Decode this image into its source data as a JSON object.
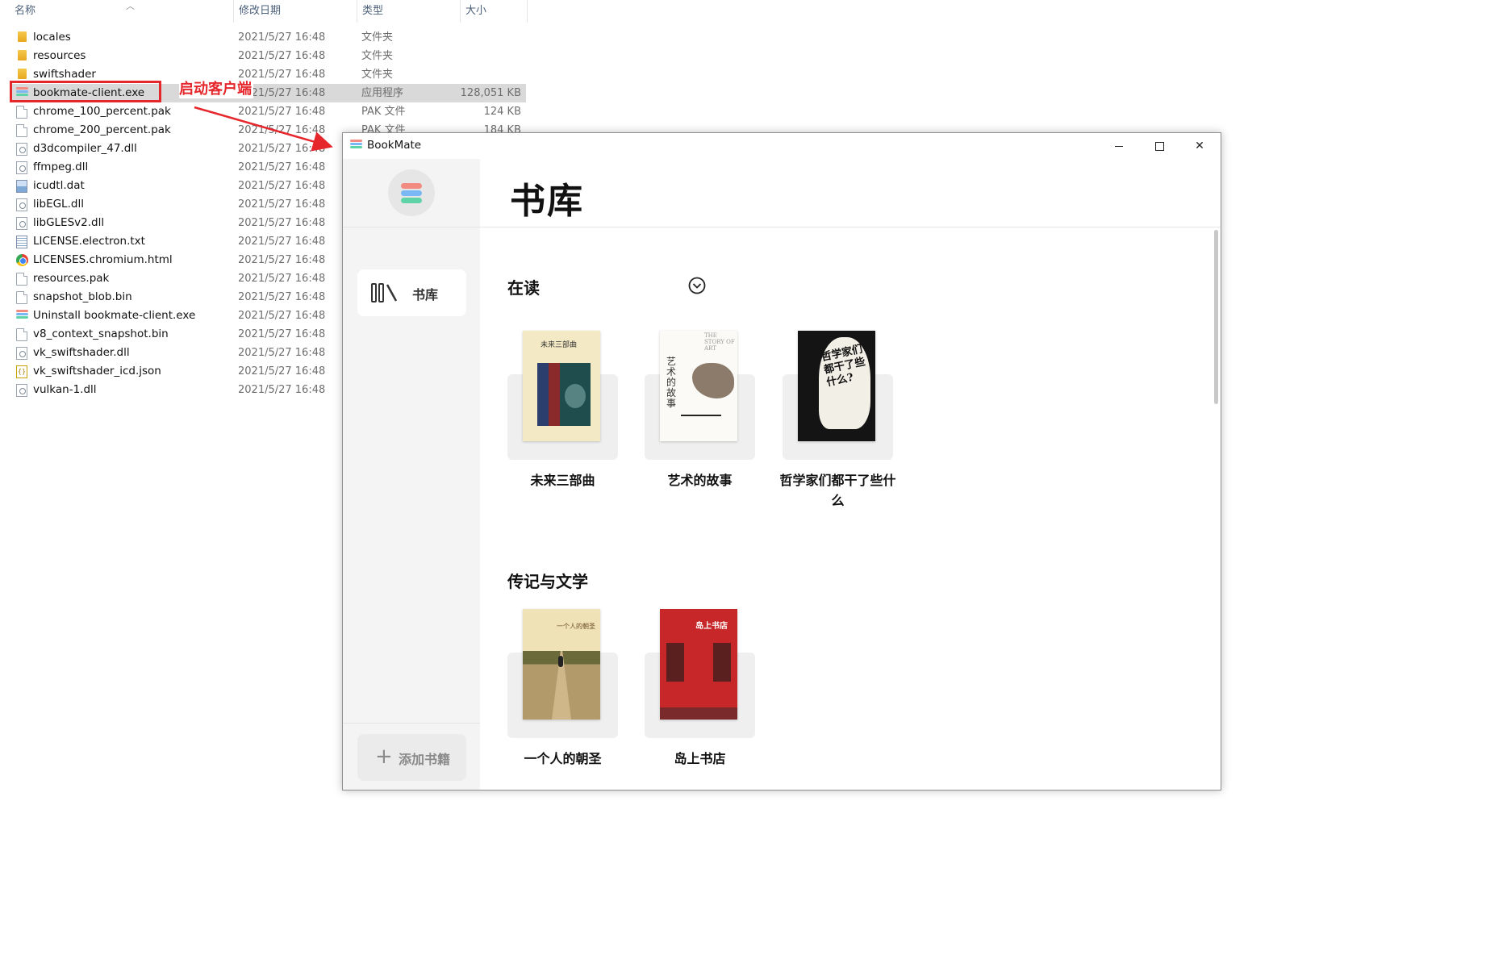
{
  "explorer": {
    "columns": {
      "name": "名称",
      "date": "修改日期",
      "type": "类型",
      "size": "大小"
    },
    "files": [
      {
        "name": "locales",
        "date": "2021/5/27 16:48",
        "type": "文件夹",
        "size": "",
        "icon": "folder-icon"
      },
      {
        "name": "resources",
        "date": "2021/5/27 16:48",
        "type": "文件夹",
        "size": "",
        "icon": "folder-icon"
      },
      {
        "name": "swiftshader",
        "date": "2021/5/27 16:48",
        "type": "文件夹",
        "size": "",
        "icon": "folder-icon"
      },
      {
        "name": "bookmate-client.exe",
        "date": "2021/5/27 16:48",
        "type": "应用程序",
        "size": "128,051 KB",
        "icon": "bookmate-app-icon"
      },
      {
        "name": "chrome_100_percent.pak",
        "date": "2021/5/27 16:48",
        "type": "PAK 文件",
        "size": "124 KB",
        "icon": "file-icon"
      },
      {
        "name": "chrome_200_percent.pak",
        "date": "2021/5/27 16:48",
        "type": "PAK 文件",
        "size": "184 KB",
        "icon": "file-icon"
      },
      {
        "name": "d3dcompiler_47.dll",
        "date": "2021/5/27 16:48",
        "type": "",
        "size": "",
        "icon": "dll-file-icon"
      },
      {
        "name": "ffmpeg.dll",
        "date": "2021/5/27 16:48",
        "type": "",
        "size": "",
        "icon": "dll-file-icon"
      },
      {
        "name": "icudtl.dat",
        "date": "2021/5/27 16:48",
        "type": "",
        "size": "",
        "icon": "image-file-icon"
      },
      {
        "name": "libEGL.dll",
        "date": "2021/5/27 16:48",
        "type": "",
        "size": "",
        "icon": "dll-file-icon"
      },
      {
        "name": "libGLESv2.dll",
        "date": "2021/5/27 16:48",
        "type": "",
        "size": "",
        "icon": "dll-file-icon"
      },
      {
        "name": "LICENSE.electron.txt",
        "date": "2021/5/27 16:48",
        "type": "",
        "size": "",
        "icon": "text-file-icon"
      },
      {
        "name": "LICENSES.chromium.html",
        "date": "2021/5/27 16:48",
        "type": "",
        "size": "",
        "icon": "chrome-icon"
      },
      {
        "name": "resources.pak",
        "date": "2021/5/27 16:48",
        "type": "",
        "size": "",
        "icon": "file-icon"
      },
      {
        "name": "snapshot_blob.bin",
        "date": "2021/5/27 16:48",
        "type": "",
        "size": "",
        "icon": "file-icon"
      },
      {
        "name": "Uninstall bookmate-client.exe",
        "date": "2021/5/27 16:48",
        "type": "",
        "size": "",
        "icon": "bookmate-app-icon"
      },
      {
        "name": "v8_context_snapshot.bin",
        "date": "2021/5/27 16:48",
        "type": "",
        "size": "",
        "icon": "file-icon"
      },
      {
        "name": "vk_swiftshader.dll",
        "date": "2021/5/27 16:48",
        "type": "",
        "size": "",
        "icon": "dll-file-icon"
      },
      {
        "name": "vk_swiftshader_icd.json",
        "date": "2021/5/27 16:48",
        "type": "",
        "size": "",
        "icon": "json-file-icon"
      },
      {
        "name": "vulkan-1.dll",
        "date": "2021/5/27 16:48",
        "type": "",
        "size": "",
        "icon": "dll-file-icon"
      }
    ],
    "selected": "bookmate-client.exe"
  },
  "annotation": {
    "label": "启动客户端",
    "color": "#e5262b"
  },
  "window": {
    "title": "BookMate",
    "controls": {
      "minimize": "minimize-icon",
      "maximize": "maximize-icon",
      "close": "✕"
    }
  },
  "sidebar": {
    "nav": [
      {
        "label": "书库",
        "icon": "library-icon",
        "active": true
      }
    ],
    "add_button": {
      "plus": "+",
      "label": "添加书籍"
    }
  },
  "main": {
    "page_title": "书库",
    "sections": [
      {
        "title": "在读",
        "collapsible": true,
        "books": [
          {
            "title": "未来三部曲",
            "cover_text": "未来三部曲"
          },
          {
            "title": "艺术的故事",
            "cover_text": "艺术的故事",
            "cover_subtext": "THE STORY OF ART"
          },
          {
            "title": "哲学家们都干了些什么",
            "cover_text": "哲学家们都干了些什么?"
          }
        ]
      },
      {
        "title": "传记与文学",
        "books": [
          {
            "title": "一个人的朝圣",
            "cover_text": "一个人的朝圣"
          },
          {
            "title": "岛上书店",
            "cover_text": "岛上书店"
          }
        ]
      }
    ]
  },
  "colors": {
    "accent_red": "#e5262b",
    "logo_stripes": [
      "#f28b82",
      "#7ab8f5",
      "#5fd3a8"
    ],
    "sidebar_bg": "#f4f4f4",
    "selection_bg": "#d9d9d9"
  }
}
